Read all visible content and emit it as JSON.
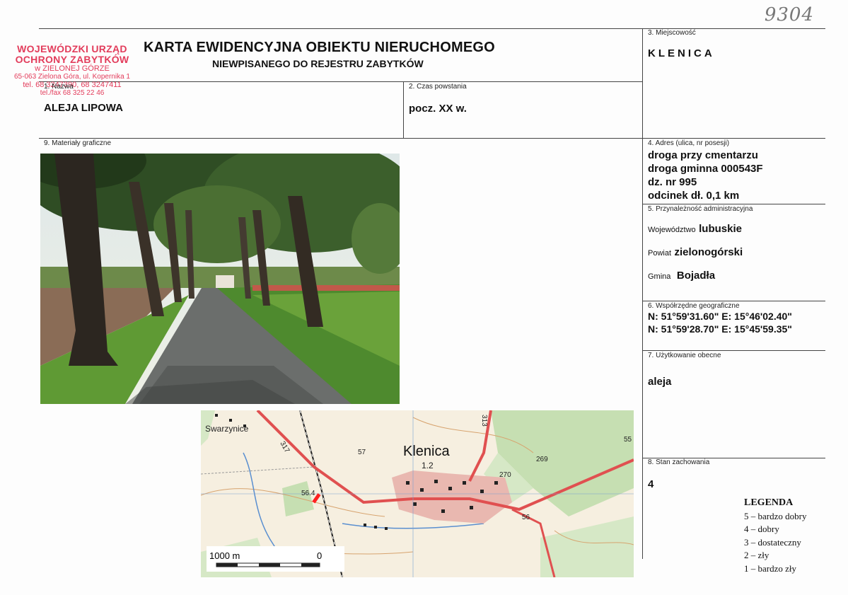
{
  "archive_number": "9304",
  "stamp": {
    "line1": "WOJEWÓDZKI URZĄD",
    "line2": "OCHRONY ZABYTKÓW",
    "line3": "w ZIELONEJ GÓRZE",
    "line4": "65-063 Zielona Góra, ul. Kopernika 1",
    "line5": "tel. 68 3247390, 68 3247411",
    "line6": "tel./fax 68 325 22 46"
  },
  "header": {
    "title": "KARTA EWIDENCYJNA OBIEKTU NIERUCHOMEGO",
    "subtitle": "NIEWPISANEGO DO REJESTRU ZABYTKÓW"
  },
  "fields": {
    "name_label": "1. Nazwa",
    "name_value": "ALEJA LIPOWA",
    "time_label": "2. Czas powstania",
    "time_value": "pocz. XX w.",
    "locality_label": "3. Miejscowość",
    "locality_value": "KLENICA",
    "address_label": "4. Adres (ulica, nr posesji)",
    "address_lines": [
      "droga przy cmentarzu",
      "droga gminna 000543F",
      "dz. nr 995",
      "odcinek dł. 0,1 km"
    ],
    "admin_label": "5. Przynależność administracyjna",
    "voivodeship_prefix": "Województwo",
    "voivodeship": "lubuskie",
    "county_prefix": "Powiat",
    "county": "zielonogórski",
    "commune_prefix": "Gmina",
    "commune": "Bojadła",
    "coords_label": "6. Współrzędne geograficzne",
    "coords_lines": [
      "N: 51°59'31.60\"  E: 15°46'02.40\"",
      "N: 51°59'28.70\"  E: 15°45'59.35\""
    ],
    "usage_label": "7. Użytkowanie obecne",
    "usage_value": "aleja",
    "condition_label": "8. Stan zachowania",
    "condition_value": "4",
    "graphics_label": "9. Materiały graficzne"
  },
  "legend": {
    "title": "LEGENDA",
    "items": [
      "5 – bardzo dobry",
      "4 – dobry",
      "3 – dostateczny",
      "2 – zły",
      "1 – bardzo zły"
    ]
  },
  "map": {
    "place_label": "Klenica",
    "village_labels": [
      "Swarzynice"
    ],
    "road_numbers": [
      "317",
      "313"
    ],
    "spot_heights": [
      "57",
      "1.2",
      "270",
      "269",
      "56.4",
      "56",
      "55"
    ],
    "scale_label_left": "1000 m",
    "scale_label_right": "0",
    "colors": {
      "road": "#e05050",
      "forest": "#bfdcaa",
      "built": "#e9b8b0",
      "marker": "#ff0000"
    }
  }
}
